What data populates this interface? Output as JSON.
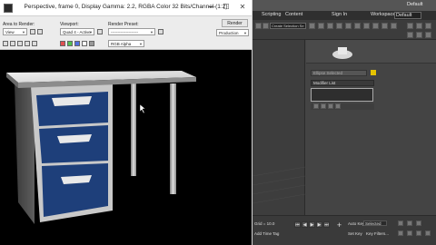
{
  "render_window": {
    "title": "Perspective, frame 0, Display Gamma: 2.2, RGBA Color 32 Bits/Channel (1:2)",
    "area_to_render": {
      "label": "Area to Render:",
      "value": "View"
    },
    "viewport": {
      "label": "Viewport:",
      "value": "Quad 4 - Active"
    },
    "render_preset": {
      "label": "Render Preset:",
      "value": "--------------------"
    },
    "render_button": "Render",
    "production_dropdown": "Production",
    "alpha_dropdown": "RGB Alpha"
  },
  "max_ui": {
    "top_strip_label": "Default",
    "menu": [
      "Scripting",
      "Content",
      "Sign In",
      "Workspaces:",
      "Default"
    ],
    "selection_set_placeholder": "Create Selection Se",
    "object_name": "Ellipse Selected",
    "object_color": "#e6c300",
    "modifier_list": "Modifier List",
    "bottom": {
      "grid": "Grid = 10.0",
      "add_time_tag": "Add Time Tag",
      "auto_key": "Auto Key",
      "selected": "Selected",
      "set_key": "Set Key",
      "key_filters": "Key Filters..."
    }
  }
}
